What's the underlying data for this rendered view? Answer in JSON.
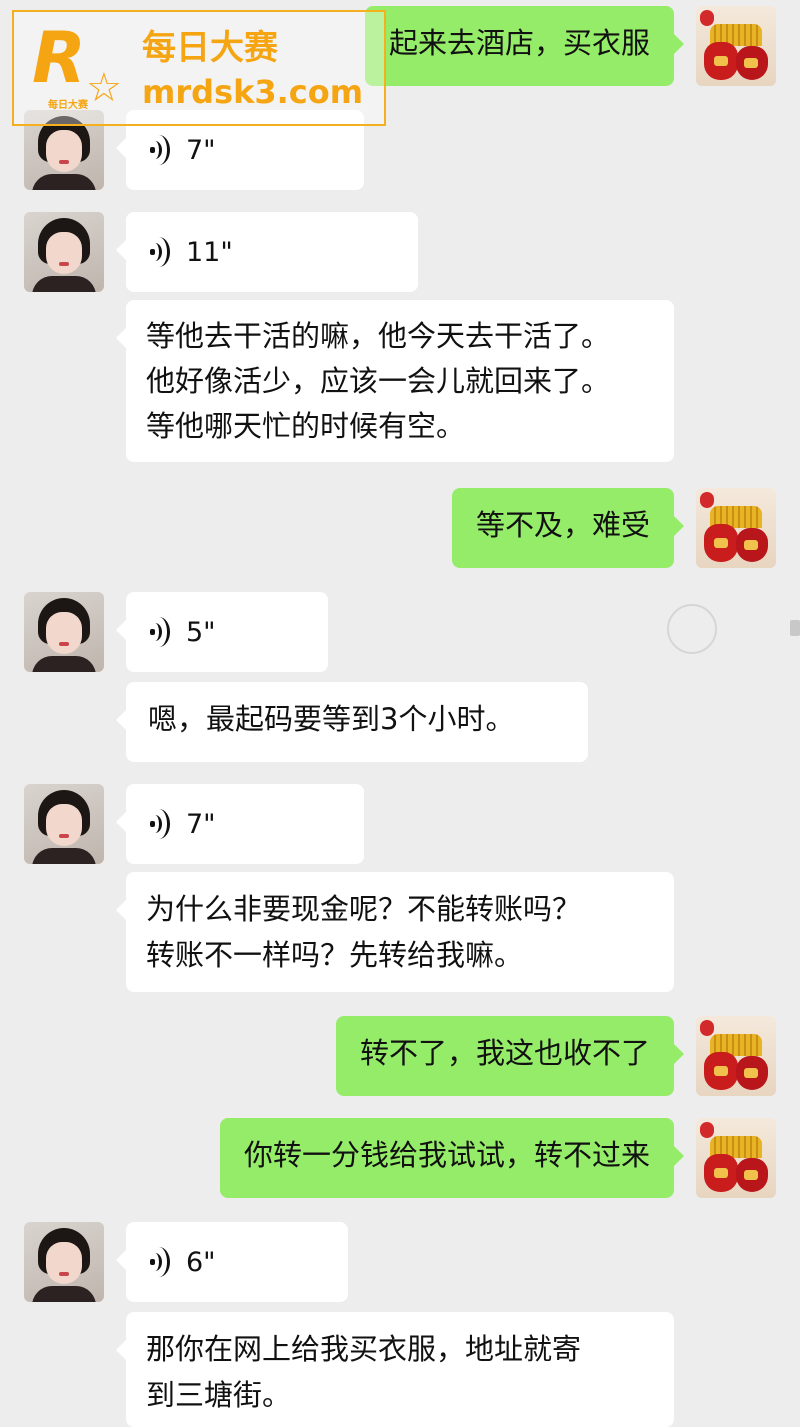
{
  "watermark": {
    "logo_letter": "R",
    "logo_sub": "每日大赛",
    "title": "每日大赛",
    "url": "mrdsk3.com",
    "color": "#f5a512"
  },
  "colors": {
    "background": "#ededed",
    "incoming_bubble": "#ffffff",
    "outgoing_bubble": "#95ec69"
  },
  "messages": [
    {
      "side": "right",
      "type": "text",
      "text": "起来去酒店，买衣服"
    },
    {
      "side": "left",
      "type": "voice",
      "duration": "7\""
    },
    {
      "side": "left",
      "type": "voice",
      "duration": "11\""
    },
    {
      "side": "left",
      "type": "text",
      "lines": [
        "等他去干活的嘛，他今天去干活了。",
        "他好像活少，应该一会儿就回来了。",
        "等他哪天忙的时候有空。"
      ]
    },
    {
      "side": "right",
      "type": "text",
      "text": "等不及，难受"
    },
    {
      "side": "left",
      "type": "voice",
      "duration": "5\""
    },
    {
      "side": "left",
      "type": "text",
      "text": "嗯，最起码要等到3个小时。"
    },
    {
      "side": "left",
      "type": "voice",
      "duration": "7\""
    },
    {
      "side": "left",
      "type": "text",
      "lines": [
        "为什么非要现金呢？不能转账吗？",
        "转账不一样吗？先转给我嘛。"
      ]
    },
    {
      "side": "right",
      "type": "text",
      "text": "转不了，我这也收不了"
    },
    {
      "side": "right",
      "type": "text",
      "text": "你转一分钱给我试试，转不过来"
    },
    {
      "side": "left",
      "type": "voice",
      "duration": "6\""
    },
    {
      "side": "left",
      "type": "text",
      "lines": [
        "那你在网上给我买衣服，地址就寄",
        "到三塘街。"
      ]
    }
  ]
}
